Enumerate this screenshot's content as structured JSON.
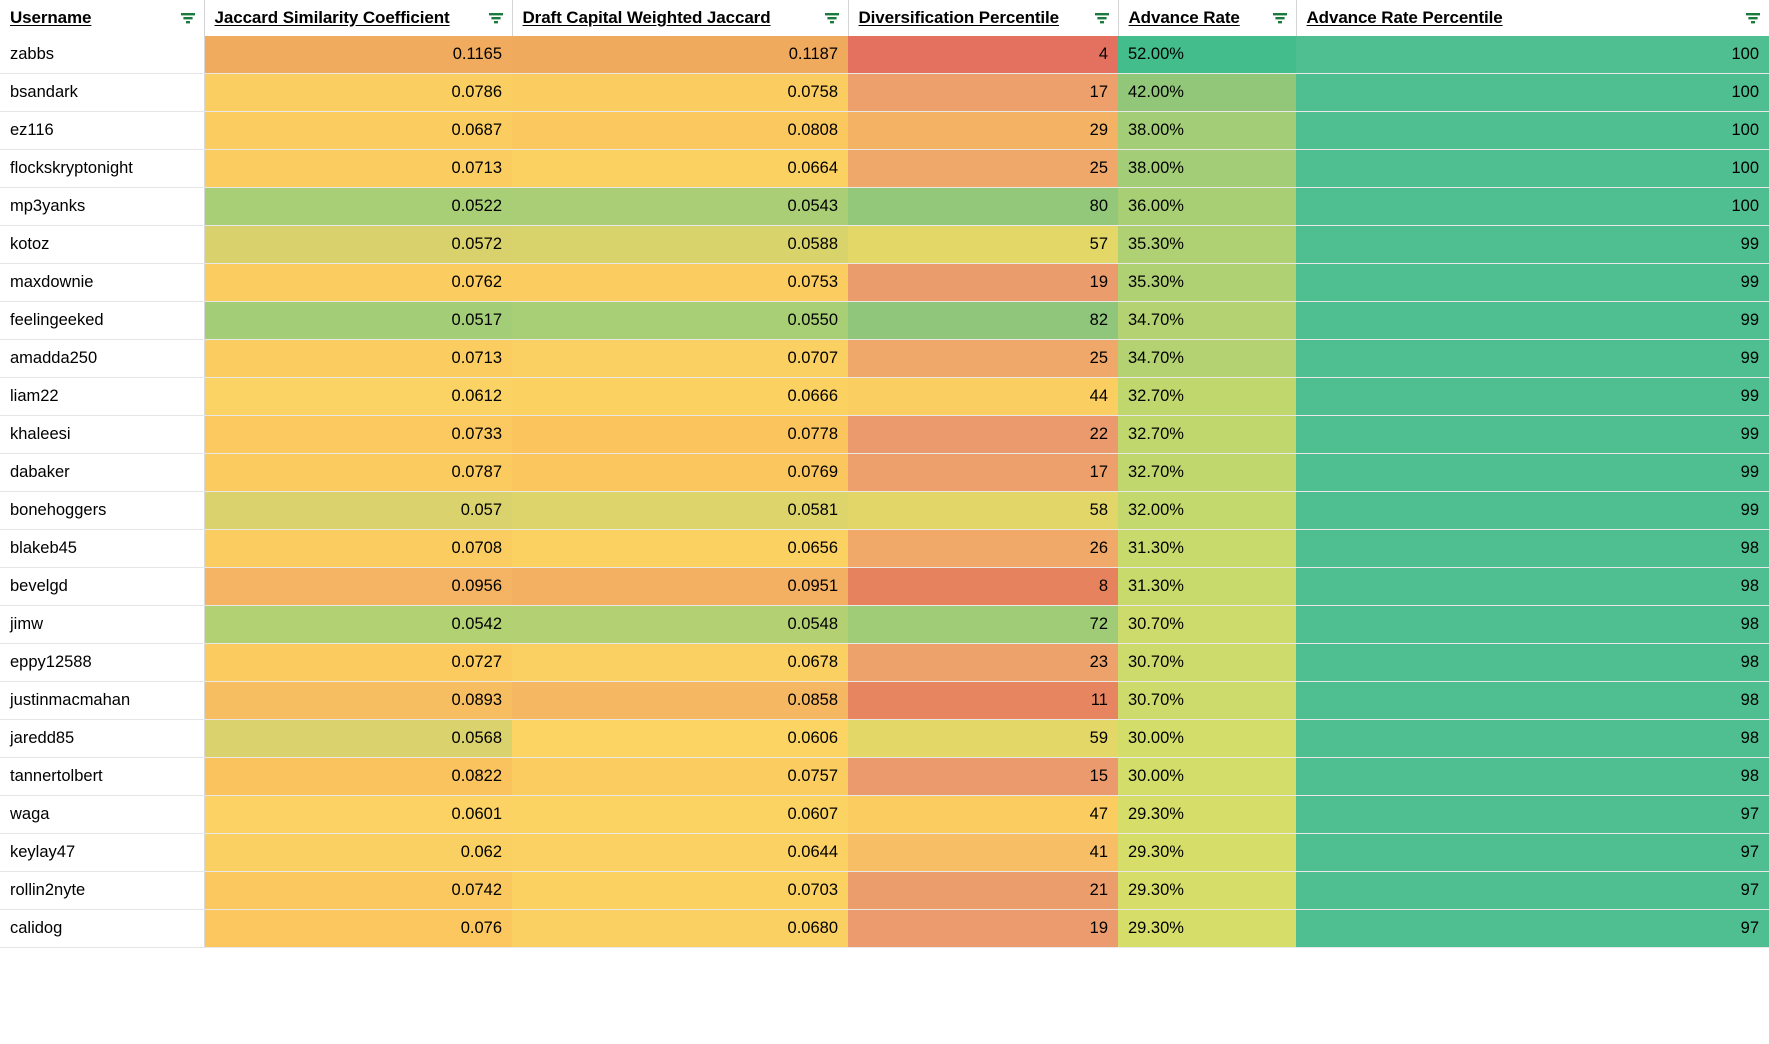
{
  "table": {
    "columns": [
      {
        "key": "username",
        "label": "Username",
        "align": "left",
        "filter_icon": "filter-icon"
      },
      {
        "key": "jaccard",
        "label": "Jaccard Similarity Coefficient",
        "align": "right",
        "filter_icon": "filter-icon"
      },
      {
        "key": "weighted",
        "label": "Draft Capital Weighted Jaccard",
        "align": "right",
        "filter_icon": "filter-icon"
      },
      {
        "key": "divpct",
        "label": "Diversification Percentile",
        "align": "right",
        "filter_icon": "filter-icon"
      },
      {
        "key": "advrate",
        "label": "Advance Rate",
        "align": "left",
        "filter_icon": "filter-icon"
      },
      {
        "key": "advpct",
        "label": "Advance Rate Percentile",
        "align": "right",
        "filter_icon": "filter-icon"
      }
    ],
    "rows": [
      {
        "username": "zabbs",
        "jaccard": "0.1165",
        "weighted": "0.1187",
        "divpct": "4",
        "advrate": "52.00%",
        "advpct": "100",
        "colors": {
          "jaccard": "#f0aa5e",
          "weighted": "#f0aa5e",
          "divpct": "#e3705e",
          "advrate": "#41bd8b",
          "advpct": "#4cbd8d"
        }
      },
      {
        "username": "bsandark",
        "jaccard": "0.0786",
        "weighted": "0.0758",
        "divpct": "17",
        "advrate": "42.00%",
        "advpct": "100",
        "colors": {
          "jaccard": "#fbcf61",
          "weighted": "#fbcf61",
          "divpct": "#eea06a",
          "advrate": "#8cc униque"
        }
      },
      {
        "username": "ez116",
        "jaccard": "0.0687",
        "weighted": "0.0808",
        "divpct": "29",
        "advrate": "38.00%",
        "advpct": "100"
      },
      {
        "username": "flockskryptonight",
        "jaccard": "0.0713",
        "weighted": "0.0664",
        "divpct": "25",
        "advrate": "38.00%",
        "advpct": "100"
      },
      {
        "username": "mp3yanks",
        "jaccard": "0.0522",
        "weighted": "0.0543",
        "divpct": "80",
        "advrate": "36.00%",
        "advpct": "100"
      },
      {
        "username": "kotoz",
        "jaccard": "0.0572",
        "weighted": "0.0588",
        "divpct": "57",
        "advrate": "35.30%",
        "advpct": "99"
      },
      {
        "username": "maxdownie",
        "jaccard": "0.0762",
        "weighted": "0.0753",
        "divpct": "19",
        "advrate": "35.30%",
        "advpct": "99"
      },
      {
        "username": "feelingeeked",
        "jaccard": "0.0517",
        "weighted": "0.0550",
        "divpct": "82",
        "advrate": "34.70%",
        "advpct": "99"
      },
      {
        "username": "amadda250",
        "jaccard": "0.0713",
        "weighted": "0.0707",
        "divpct": "25",
        "advrate": "34.70%",
        "advpct": "99"
      },
      {
        "username": "liam22",
        "jaccard": "0.0612",
        "weighted": "0.0666",
        "divpct": "44",
        "advrate": "32.70%",
        "advpct": "99"
      },
      {
        "username": "khaleesi",
        "jaccard": "0.0733",
        "weighted": "0.0778",
        "divpct": "22",
        "advrate": "32.70%",
        "advpct": "99"
      },
      {
        "username": "dabaker",
        "jaccard": "0.0787",
        "weighted": "0.0769",
        "divpct": "17",
        "advrate": "32.70%",
        "advpct": "99"
      },
      {
        "username": "bonehoggers",
        "jaccard": "0.057",
        "weighted": "0.0581",
        "divpct": "58",
        "advrate": "32.00%",
        "advpct": "99"
      },
      {
        "username": "blakeb45",
        "jaccard": "0.0708",
        "weighted": "0.0656",
        "divpct": "26",
        "advrate": "31.30%",
        "advpct": "98"
      },
      {
        "username": "bevelgd",
        "jaccard": "0.0956",
        "weighted": "0.0951",
        "divpct": "8",
        "advrate": "31.30%",
        "advpct": "98"
      },
      {
        "username": "jimw",
        "jaccard": "0.0542",
        "weighted": "0.0548",
        "divpct": "72",
        "advrate": "30.70%",
        "advpct": "98"
      },
      {
        "username": "eppy12588",
        "jaccard": "0.0727",
        "weighted": "0.0678",
        "divpct": "23",
        "advrate": "30.70%",
        "advpct": "98"
      },
      {
        "username": "justinmacmahan",
        "jaccard": "0.0893",
        "weighted": "0.0858",
        "divpct": "11",
        "advrate": "30.70%",
        "advpct": "98"
      },
      {
        "username": "jaredd85",
        "jaccard": "0.0568",
        "weighted": "0.0606",
        "divpct": "59",
        "advrate": "30.00%",
        "advpct": "98"
      },
      {
        "username": "tannertolbert",
        "jaccard": "0.0822",
        "weighted": "0.0757",
        "divpct": "15",
        "advrate": "30.00%",
        "advpct": "98"
      },
      {
        "username": "waga",
        "jaccard": "0.0601",
        "weighted": "0.0607",
        "divpct": "47",
        "advrate": "29.30%",
        "advpct": "97"
      },
      {
        "username": "keylay47",
        "jaccard": "0.062",
        "weighted": "0.0644",
        "divpct": "41",
        "advrate": "29.30%",
        "advpct": "97"
      },
      {
        "username": "rollin2nyte",
        "jaccard": "0.0742",
        "weighted": "0.0703",
        "divpct": "21",
        "advrate": "29.30%",
        "advpct": "97"
      },
      {
        "username": "calidog",
        "jaccard": "0.076",
        "weighted": "0.0680",
        "divpct": "19",
        "advrate": "29.30%",
        "advpct": "97"
      }
    ],
    "cell_colors": [
      {
        "jaccard": "#f0ab5f",
        "weighted": "#f0aa5e",
        "divpct": "#e4715f",
        "advrate": "#43bd8c",
        "advpct": "#4fbe90"
      },
      {
        "jaccard": "#fbce61",
        "weighted": "#fbcd60",
        "divpct": "#eda06b",
        "advrate": "#92c77a",
        "advpct": "#4fbe90"
      },
      {
        "jaccard": "#fbcd60",
        "weighted": "#fbc85f",
        "divpct": "#f3b264",
        "advrate": "#a3cd76",
        "advpct": "#4fbe90"
      },
      {
        "jaccard": "#fbcc60",
        "weighted": "#fbd162",
        "divpct": "#efa76a",
        "advrate": "#a3cd76",
        "advpct": "#4fbe90"
      },
      {
        "jaccard": "#a8ce76",
        "weighted": "#a9ce76",
        "divpct": "#93c87a",
        "advrate": "#a9cf75",
        "advpct": "#4fbe90"
      },
      {
        "jaccard": "#d9d16c",
        "weighted": "#d9d36c",
        "divpct": "#e3d768",
        "advrate": "#afd174",
        "advpct": "#4fbe90"
      },
      {
        "jaccard": "#fbcc60",
        "weighted": "#fbcd60",
        "divpct": "#eb9c6c",
        "advrate": "#afd174",
        "advpct": "#4fbe90"
      },
      {
        "jaccard": "#a4cd77",
        "weighted": "#a8ce76",
        "divpct": "#8fc67b",
        "advrate": "#b4d272",
        "advpct": "#4fbe90"
      },
      {
        "jaccard": "#fbcc60",
        "weighted": "#fbd062",
        "divpct": "#efa76a",
        "advrate": "#b4d272",
        "advpct": "#4fbe90"
      },
      {
        "jaccard": "#fbd364",
        "weighted": "#fbd162",
        "divpct": "#fbce61",
        "advrate": "#c0d76e",
        "advpct": "#4fbe90"
      },
      {
        "jaccard": "#fbc95f",
        "weighted": "#fbc45d",
        "divpct": "#ea9a6d",
        "advrate": "#c0d76e",
        "advpct": "#4fbe90"
      },
      {
        "jaccard": "#fbcb5f",
        "weighted": "#fbc65e",
        "divpct": "#eda06b",
        "advrate": "#c0d76e",
        "advpct": "#4fbe90"
      },
      {
        "jaccard": "#dad26c",
        "weighted": "#ddd46b",
        "divpct": "#e2d668",
        "advrate": "#c4d96d",
        "advpct": "#4fbe90"
      },
      {
        "jaccard": "#fbcd60",
        "weighted": "#fbd262",
        "divpct": "#f0a969",
        "advrate": "#c9da6c",
        "advpct": "#4fbe90"
      },
      {
        "jaccard": "#f4b463",
        "weighted": "#f3b063",
        "divpct": "#e7825f",
        "advrate": "#c9da6c",
        "advpct": "#4fbe90"
      },
      {
        "jaccard": "#b2d173",
        "weighted": "#b3d173",
        "divpct": "#a0cb77",
        "advrate": "#ccdb6b",
        "advpct": "#4fbe90"
      },
      {
        "jaccard": "#fbcb5f",
        "weighted": "#fbd062",
        "divpct": "#eda16b",
        "advrate": "#ccdb6b",
        "advpct": "#4fbe90"
      },
      {
        "jaccard": "#f7bd61",
        "weighted": "#f5b762",
        "divpct": "#e78561",
        "advrate": "#ccdb6b",
        "advpct": "#4fbe90"
      },
      {
        "jaccard": "#dad26c",
        "weighted": "#fbd464",
        "divpct": "#e3d768",
        "advrate": "#d2dd6a",
        "advpct": "#4fbe90"
      },
      {
        "jaccard": "#fbc35d",
        "weighted": "#fbcd60",
        "divpct": "#eb9a6d",
        "advrate": "#d2dd6a",
        "advpct": "#4fbe90"
      },
      {
        "jaccard": "#fbd263",
        "weighted": "#fbd363",
        "divpct": "#fbcd60",
        "advrate": "#d6de69",
        "advpct": "#4fbe90"
      },
      {
        "jaccard": "#fbd062",
        "weighted": "#fbd163",
        "divpct": "#f7be65",
        "advrate": "#d6de69",
        "advpct": "#4fbe90"
      },
      {
        "jaccard": "#fbc85f",
        "weighted": "#fbd162",
        "divpct": "#ec9d6c",
        "advrate": "#d6de69",
        "advpct": "#4fbe90"
      },
      {
        "jaccard": "#fbc75e",
        "weighted": "#fbd062",
        "divpct": "#eb9b6d",
        "advrate": "#d6de69",
        "advpct": "#4fbe90"
      }
    ]
  },
  "theme": {
    "filter_icon_color": "#1b7a3d",
    "grid_line": "#d9d9d9",
    "text_color": "#000000"
  }
}
